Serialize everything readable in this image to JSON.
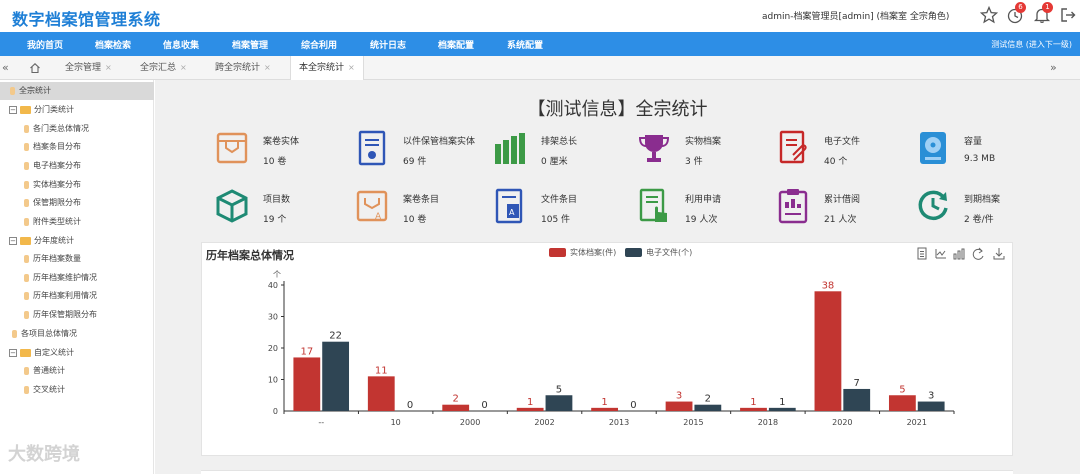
{
  "app": {
    "title": "数字档案馆管理系统",
    "user_info": "admin-档案管理员[admin] (档案室 全宗角色)",
    "badge_history": "6",
    "badge_notify": "1"
  },
  "nav": {
    "items": [
      "我的首页",
      "档案检索",
      "信息收集",
      "档案管理",
      "综合利用",
      "统计日志",
      "档案配置",
      "系统配置"
    ],
    "right_text": "测试信息 (进入下一级)"
  },
  "tabs": [
    "全宗管理",
    "全宗汇总",
    "跨全宗统计",
    "本全宗统计"
  ],
  "sidebar": {
    "root": "全宗统计",
    "groups": [
      {
        "label": "分门类统计",
        "items": [
          "各门类总体情况",
          "档案条目分布",
          "电子档案分布",
          "实体档案分布",
          "保管期限分布",
          "附件类型统计"
        ]
      },
      {
        "label": "分年度统计",
        "items": [
          "历年档案数量",
          "历年档案维护情况",
          "历年档案利用情况",
          "历年保管期限分布"
        ]
      }
    ],
    "standalone": "各项目总体情况",
    "custom_group": {
      "label": "自定义统计",
      "items": [
        "普通统计",
        "交叉统计"
      ]
    }
  },
  "main": {
    "title": "【测试信息】全宗统计",
    "stats": [
      {
        "label": "案卷实体",
        "value": "10 卷",
        "icon": "archive-box-icon",
        "color": "#e0925a"
      },
      {
        "label": "以件保管档案实体",
        "value": "69 件",
        "icon": "document-seal-icon",
        "color": "#2f56b6"
      },
      {
        "label": "排架总长",
        "value": "0 厘米",
        "icon": "bookshelf-icon",
        "color": "#3c9a46"
      },
      {
        "label": "实物档案",
        "value": "3 件",
        "icon": "trophy-icon",
        "color": "#8a2d8f"
      },
      {
        "label": "电子文件",
        "value": "40 个",
        "icon": "file-attachment-icon",
        "color": "#c62828"
      },
      {
        "label": "容量",
        "value": "9.3 MB",
        "icon": "hard-disk-icon",
        "color": "#2a8fd6"
      },
      {
        "label": "项目数",
        "value": "19 个",
        "icon": "cube-icon",
        "color": "#1e8a74"
      },
      {
        "label": "案卷条目",
        "value": "10 卷",
        "icon": "archive-sort-icon",
        "color": "#e0925a"
      },
      {
        "label": "文件条目",
        "value": "105 件",
        "icon": "file-sort-icon",
        "color": "#2f56b6"
      },
      {
        "label": "利用申请",
        "value": "19 人次",
        "icon": "form-hand-icon",
        "color": "#3c9a46"
      },
      {
        "label": "累计借阅",
        "value": "21 人次",
        "icon": "clipboard-chart-icon",
        "color": "#8a2d8f"
      },
      {
        "label": "到期档案",
        "value": "2 卷/件",
        "icon": "clock-icon",
        "color": "#1e8a74"
      }
    ]
  },
  "chart_data": {
    "type": "bar",
    "title": "历年档案总体情况",
    "ylabel": "个",
    "xlabel": "",
    "ylim": [
      0,
      40
    ],
    "yticks": [
      0,
      10,
      20,
      30,
      40
    ],
    "categories": [
      "--",
      "10",
      "2000",
      "2002",
      "2013",
      "2015",
      "2018",
      "2020",
      "2021"
    ],
    "series": [
      {
        "name": "实体档案(件)",
        "color": "#c23531",
        "values": [
          17,
          11,
          2,
          1,
          1,
          3,
          1,
          38,
          5
        ]
      },
      {
        "name": "电子文件(个)",
        "color": "#2f4554",
        "values": [
          22,
          0,
          0,
          5,
          0,
          2,
          1,
          7,
          3
        ]
      }
    ],
    "legend_position": "top-center",
    "grid": false
  },
  "watermark": "大数跨境"
}
